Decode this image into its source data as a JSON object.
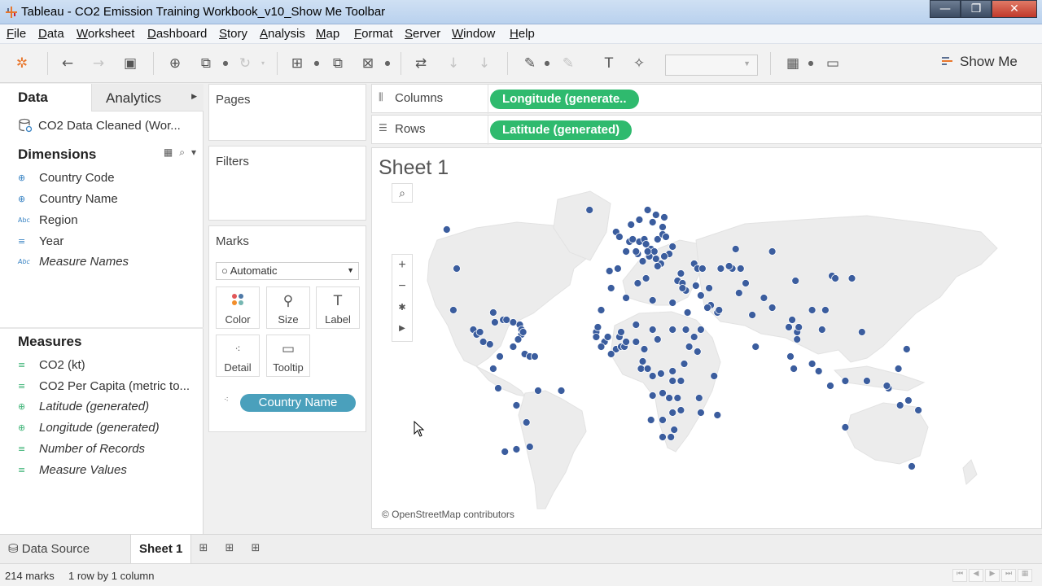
{
  "window": {
    "title": "Tableau - CO2 Emission Training Workbook_v10_Show Me Toolbar",
    "buttons": [
      "—",
      "❐",
      "✕"
    ]
  },
  "menu": [
    "File",
    "Data",
    "Worksheet",
    "Dashboard",
    "Story",
    "Analysis",
    "Map",
    "Format",
    "Server",
    "Window",
    "Help"
  ],
  "toolbar": {
    "show_me_label": "Show Me",
    "fit_value": ""
  },
  "data_pane": {
    "tab_data": "Data",
    "tab_analytics": "Analytics",
    "datasource": "CO2 Data Cleaned (Wor...",
    "dimensions_header": "Dimensions",
    "dimensions": [
      {
        "label": "Country Code",
        "icon": "geo-icon"
      },
      {
        "label": "Country Name",
        "icon": "geo-icon"
      },
      {
        "label": "Region",
        "icon": "abc-icon"
      },
      {
        "label": "Year",
        "icon": "number-icon"
      },
      {
        "label": "Measure Names",
        "icon": "abc-icon"
      }
    ],
    "measures_header": "Measures",
    "measures": [
      {
        "label": "CO2 (kt)",
        "icon": "number-icon"
      },
      {
        "label": "CO2 Per Capita (metric to...",
        "icon": "number-icon"
      },
      {
        "label": "Latitude (generated)",
        "icon": "geo-icon"
      },
      {
        "label": "Longitude (generated)",
        "icon": "geo-icon"
      },
      {
        "label": "Number of Records",
        "icon": "number-icon"
      },
      {
        "label": "Measure Values",
        "icon": "number-icon"
      }
    ]
  },
  "cards": {
    "pages": "Pages",
    "filters": "Filters",
    "marks": "Marks",
    "mark_type": "Automatic",
    "mark_buttons": [
      "Color",
      "Size",
      "Label",
      "Detail",
      "Tooltip"
    ],
    "detail_pill": "Country Name"
  },
  "shelves": {
    "columns_label": "Columns",
    "columns_pill": "Longitude (generate..",
    "rows_label": "Rows",
    "rows_pill": "Latitude (generated)"
  },
  "view": {
    "sheet_title": "Sheet 1",
    "attribution": "© OpenStreetMap contributors",
    "mark_color": "#3b5d9e",
    "map_points": [
      [
        -65,
        78
      ],
      [
        -20,
        64
      ],
      [
        -4,
        55
      ],
      [
        5,
        58
      ],
      [
        10,
        60
      ],
      [
        20,
        62
      ],
      [
        25,
        61
      ],
      [
        15,
        64
      ],
      [
        18,
        59
      ],
      [
        24,
        57
      ],
      [
        -2,
        53
      ],
      [
        4,
        51
      ],
      [
        6,
        52
      ],
      [
        10,
        51
      ],
      [
        13,
        52
      ],
      [
        14,
        50
      ],
      [
        17,
        48
      ],
      [
        19,
        47
      ],
      [
        21,
        52
      ],
      [
        24,
        54
      ],
      [
        26,
        53
      ],
      [
        30,
        49
      ],
      [
        28,
        46
      ],
      [
        25,
        45
      ],
      [
        23,
        42
      ],
      [
        21,
        41
      ],
      [
        20,
        44
      ],
      [
        16,
        45
      ],
      [
        12,
        43
      ],
      [
        15,
        47
      ],
      [
        9,
        46
      ],
      [
        8,
        47
      ],
      [
        2,
        47
      ],
      [
        -3,
        40
      ],
      [
        -8,
        39
      ],
      [
        14,
        36
      ],
      [
        33,
        35
      ],
      [
        35,
        38
      ],
      [
        36,
        34
      ],
      [
        43,
        42
      ],
      [
        45,
        40
      ],
      [
        48,
        40
      ],
      [
        52,
        32
      ],
      [
        53,
        25
      ],
      [
        57,
        22
      ],
      [
        47,
        29
      ],
      [
        44,
        33
      ],
      [
        38,
        31
      ],
      [
        36,
        32
      ],
      [
        39,
        22
      ],
      [
        47,
        15
      ],
      [
        51,
        24
      ],
      [
        58,
        23
      ],
      [
        66,
        40
      ],
      [
        70,
        30
      ],
      [
        74,
        34
      ],
      [
        78,
        21
      ],
      [
        90,
        24
      ],
      [
        85,
        28
      ],
      [
        80,
        8
      ],
      [
        71,
        40
      ],
      [
        64,
        41
      ],
      [
        59,
        40
      ],
      [
        68,
        48
      ],
      [
        90,
        47
      ],
      [
        104,
        35
      ],
      [
        100,
        16
      ],
      [
        105,
        14
      ],
      [
        106,
        16
      ],
      [
        102,
        19
      ],
      [
        101,
        4
      ],
      [
        114,
        1
      ],
      [
        114,
        23
      ],
      [
        120,
        15
      ],
      [
        126,
        37
      ],
      [
        128,
        36
      ],
      [
        138,
        36
      ],
      [
        122,
        23
      ],
      [
        134,
        -6
      ],
      [
        125,
        -8
      ],
      [
        118,
        -2
      ],
      [
        103,
        -1
      ],
      [
        105,
        11
      ],
      [
        134,
        -25
      ],
      [
        147,
        -6
      ],
      [
        160,
        -9
      ],
      [
        167,
        -16
      ],
      [
        178,
        -18
      ],
      [
        174,
        -41
      ],
      [
        159,
        -8
      ],
      [
        166,
        -1
      ],
      [
        171,
        7
      ],
      [
        172,
        -14
      ],
      [
        -175,
        -21
      ],
      [
        -150,
        -17
      ],
      [
        -170,
        -14
      ],
      [
        144,
        14
      ],
      [
        -106,
        56
      ],
      [
        -100,
        40
      ],
      [
        -102,
        23
      ],
      [
        -90,
        15
      ],
      [
        -88,
        13
      ],
      [
        -86,
        14
      ],
      [
        -84,
        10
      ],
      [
        -80,
        9
      ],
      [
        -78,
        22
      ],
      [
        -77,
        18
      ],
      [
        -72,
        19
      ],
      [
        -70,
        19
      ],
      [
        -66,
        18
      ],
      [
        -61,
        13
      ],
      [
        -62,
        17
      ],
      [
        -63,
        11
      ],
      [
        -61,
        15
      ],
      [
        -60,
        14
      ],
      [
        -66,
        8
      ],
      [
        -59,
        5
      ],
      [
        -56,
        4
      ],
      [
        -53,
        4
      ],
      [
        -74,
        4
      ],
      [
        -78,
        -1
      ],
      [
        -75,
        -9
      ],
      [
        -64,
        -16
      ],
      [
        -58,
        -23
      ],
      [
        -56,
        -33
      ],
      [
        -71,
        -35
      ],
      [
        -64,
        -34
      ],
      [
        -51,
        -10
      ],
      [
        -37,
        -10
      ],
      [
        -16,
        14
      ],
      [
        -11,
        10
      ],
      [
        -9,
        12
      ],
      [
        -4,
        7
      ],
      [
        -1,
        8
      ],
      [
        1,
        8
      ],
      [
        2,
        10
      ],
      [
        -2,
        12
      ],
      [
        8,
        10
      ],
      [
        8,
        17
      ],
      [
        18,
        15
      ],
      [
        21,
        11
      ],
      [
        13,
        7
      ],
      [
        12,
        2
      ],
      [
        11,
        -1
      ],
      [
        15,
        -1
      ],
      [
        18,
        -4
      ],
      [
        23,
        -3
      ],
      [
        30,
        -2
      ],
      [
        30,
        -6
      ],
      [
        35,
        -6
      ],
      [
        37,
        1
      ],
      [
        40,
        8
      ],
      [
        45,
        6
      ],
      [
        43,
        12
      ],
      [
        38,
        15
      ],
      [
        30,
        15
      ],
      [
        30,
        26
      ],
      [
        18,
        27
      ],
      [
        2,
        28
      ],
      [
        9,
        34
      ],
      [
        -7,
        32
      ],
      [
        -13,
        23
      ],
      [
        -15,
        16
      ],
      [
        -16,
        12
      ],
      [
        -13,
        8
      ],
      [
        -7,
        5
      ],
      [
        -1,
        14
      ],
      [
        24,
        -11
      ],
      [
        28,
        -13
      ],
      [
        33,
        -13
      ],
      [
        35,
        -18
      ],
      [
        30,
        -19
      ],
      [
        24,
        -22
      ],
      [
        31,
        -26
      ],
      [
        29,
        -29
      ],
      [
        24,
        -29
      ],
      [
        47,
        -19
      ],
      [
        57,
        -20
      ],
      [
        55,
        -4
      ],
      [
        46,
        -13
      ],
      [
        18,
        -12
      ],
      [
        17,
        -22
      ]
    ]
  },
  "bottom": {
    "data_source_tab": "Data Source",
    "sheet_tab": "Sheet 1",
    "marks_status": "214 marks",
    "dims_status": "1 row by 1 column"
  }
}
